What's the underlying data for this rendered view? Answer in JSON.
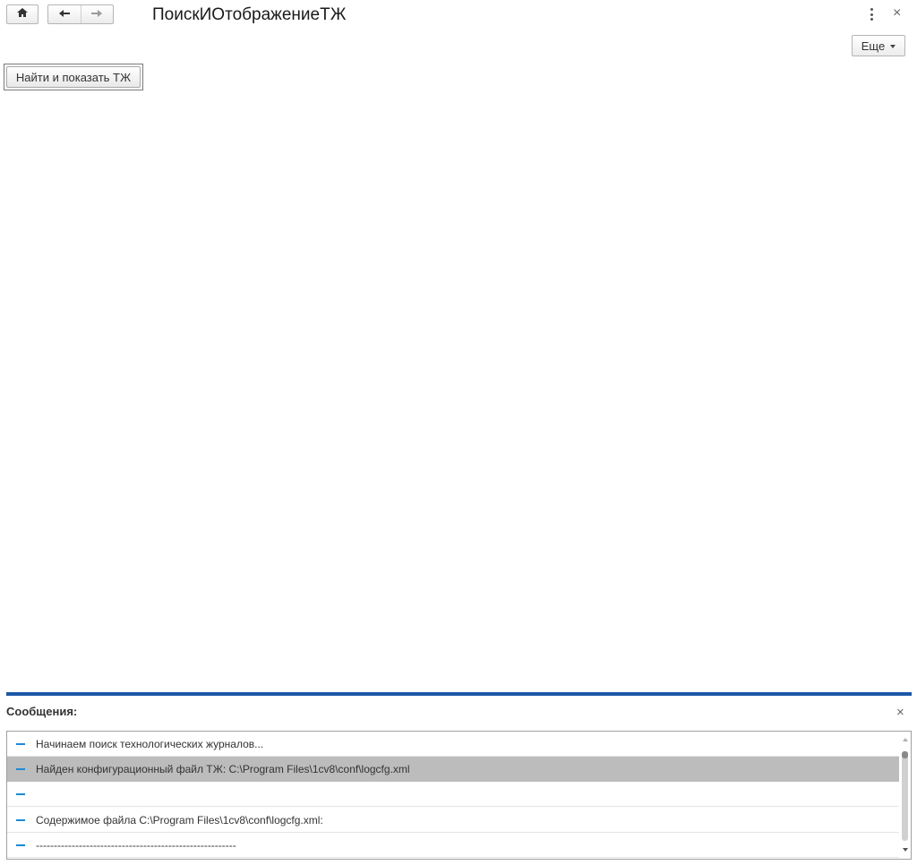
{
  "header": {
    "title": "ПоискИОтображениеТЖ",
    "home_icon": "home-icon",
    "back_icon": "arrow-left-icon",
    "forward_icon": "arrow-right-icon",
    "menu_icon": "kebab-menu-icon",
    "close_symbol": "×"
  },
  "toolbar": {
    "more_label": "Еще",
    "find_button_label": "Найти и показать ТЖ"
  },
  "messages": {
    "title": "Сообщения:",
    "close_symbol": "×",
    "accent_color": "#1d57a6",
    "items": [
      {
        "text": "Начинаем поиск технологических журналов..."
      },
      {
        "text": "Найден конфигурационный файл ТЖ: C:\\Program Files\\1cv8\\conf\\logcfg.xml",
        "selected": true
      },
      {
        "text": ""
      },
      {
        "text": "Содержимое файла C:\\Program Files\\1cv8\\conf\\logcfg.xml:"
      },
      {
        "text": "--------------------------------------------------------"
      }
    ]
  }
}
